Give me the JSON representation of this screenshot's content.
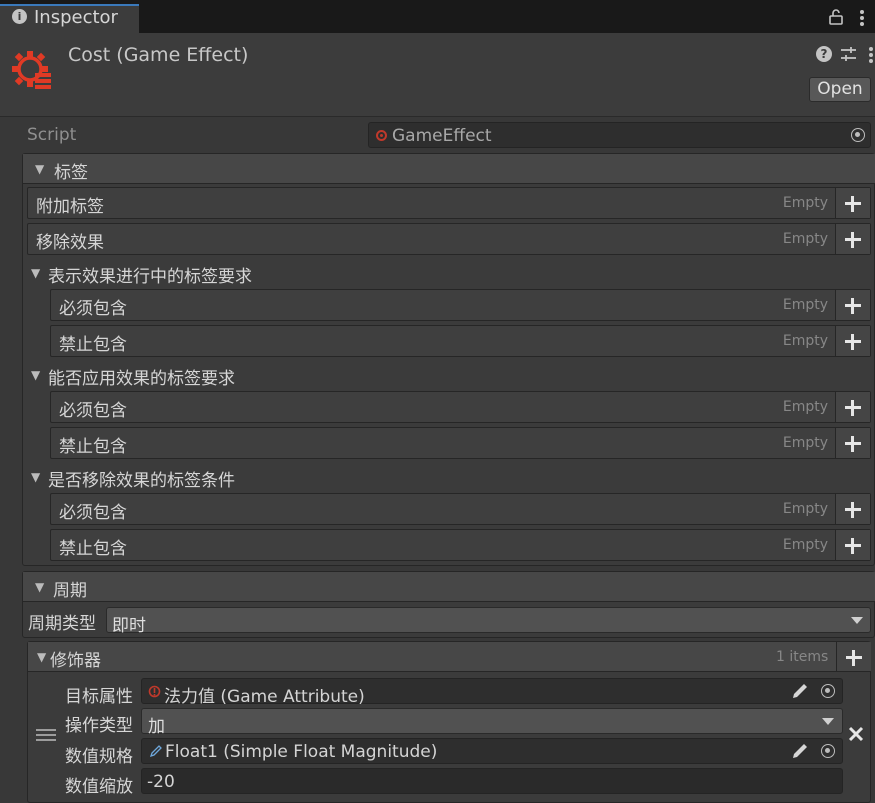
{
  "tab": {
    "label": "Inspector"
  },
  "header": {
    "title": "Cost (Game Effect)",
    "open_button": "Open",
    "brand_color": "#e03a25"
  },
  "script_row": {
    "label": "Script",
    "value": "GameEffect"
  },
  "tags_section": {
    "title": "标签",
    "rows": [
      {
        "label": "附加标签",
        "value": "Empty"
      },
      {
        "label": "移除效果",
        "value": "Empty"
      }
    ],
    "groups": [
      {
        "title": "表示效果进行中的标签要求",
        "rows": [
          {
            "label": "必须包含",
            "value": "Empty"
          },
          {
            "label": "禁止包含",
            "value": "Empty"
          }
        ]
      },
      {
        "title": "能否应用效果的标签要求",
        "rows": [
          {
            "label": "必须包含",
            "value": "Empty"
          },
          {
            "label": "禁止包含",
            "value": "Empty"
          }
        ]
      },
      {
        "title": "是否移除效果的标签条件",
        "rows": [
          {
            "label": "必须包含",
            "value": "Empty"
          },
          {
            "label": "禁止包含",
            "value": "Empty"
          }
        ]
      }
    ]
  },
  "period_section": {
    "title": "周期",
    "type_label": "周期类型",
    "type_value": "即时"
  },
  "modifiers_section": {
    "title": "修饰器",
    "count": "1 items",
    "item": {
      "target_label": "目标属性",
      "target_value": "法力值 (Game Attribute)",
      "op_label": "操作类型",
      "op_value": "加",
      "spec_label": "数值规格",
      "spec_value": "Float1 (Simple Float Magnitude)",
      "scale_label": "数值缩放",
      "scale_value": "-20"
    }
  }
}
